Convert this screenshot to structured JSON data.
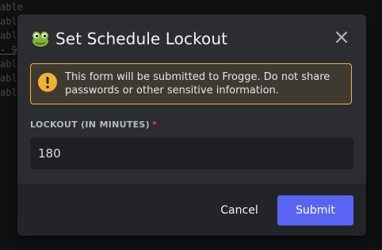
{
  "background": {
    "lines": [
      "able",
      "able",
      "able",
      "- 9",
      "able",
      "able",
      "able"
    ]
  },
  "modal": {
    "title": "Set Schedule Lockout",
    "title_icon": "frog-icon",
    "close_icon": "close-icon",
    "warning": {
      "icon": "exclamation-icon",
      "text": "This form will be submitted to Frogge. Do not share passwords or other sensitive information.",
      "border_color": "#f0b232"
    },
    "field": {
      "label": "LOCKOUT (IN MINUTES)",
      "required_mark": "*",
      "value": "180"
    },
    "footer": {
      "cancel_label": "Cancel",
      "submit_label": "Submit",
      "submit_color": "#5865f2"
    }
  }
}
